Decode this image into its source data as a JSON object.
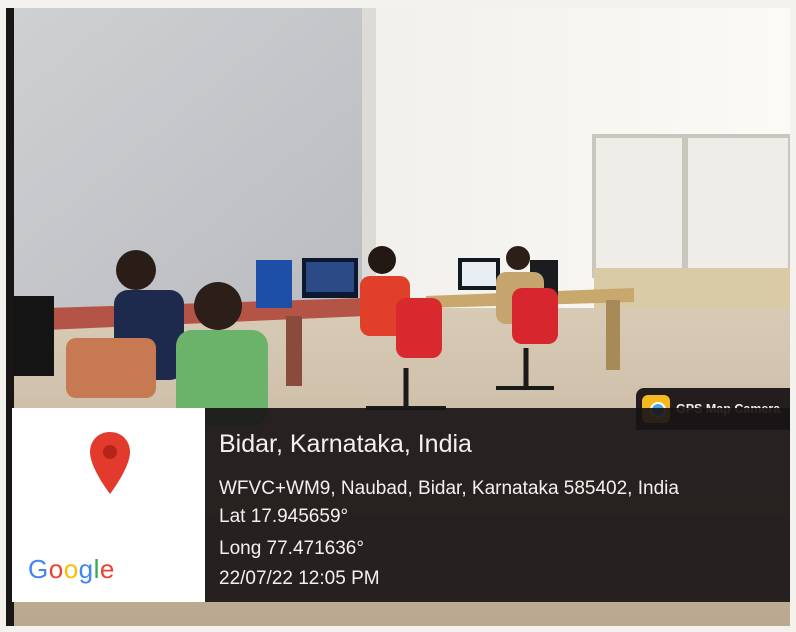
{
  "badge": {
    "icon": "gps-map-camera-logo-icon",
    "label": "GPS Map Camera"
  },
  "map": {
    "icon": "location-pin-icon",
    "brand": "Google",
    "pin_color": "#e23b2e"
  },
  "location": {
    "title": "Bidar, Karnataka, India",
    "address": "WFVC+WM9, Naubad, Bidar, Karnataka 585402, India",
    "lat": "Lat 17.945659°",
    "long": "Long 77.471636°",
    "datetime": "22/07/22 12:05 PM"
  }
}
